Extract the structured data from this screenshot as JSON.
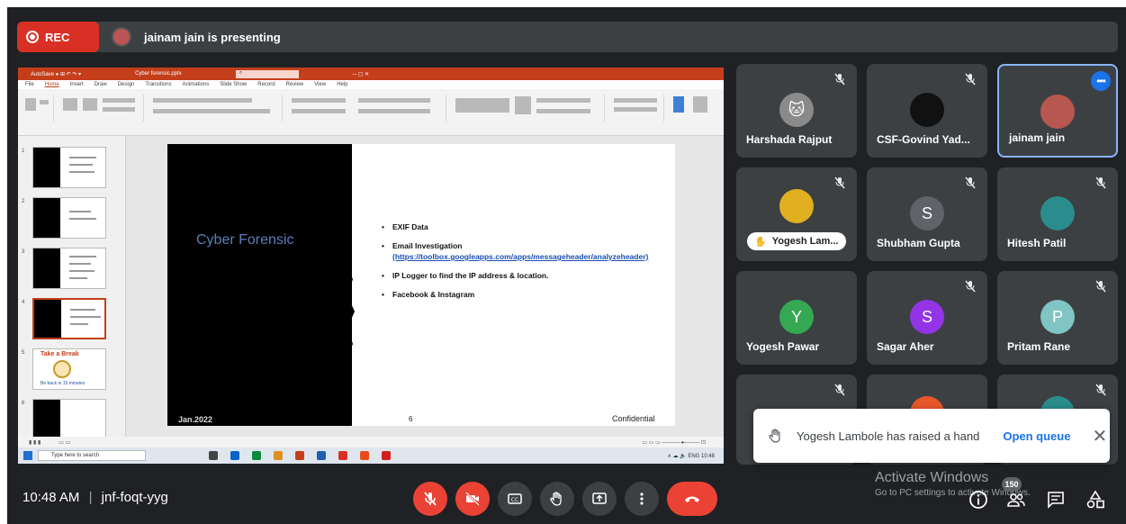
{
  "recording": {
    "label": "REC"
  },
  "presenter": {
    "text": "jainam jain is presenting"
  },
  "powerpoint": {
    "slide": {
      "title": "Cyber Forensic",
      "bullets": [
        "EXIF Data",
        "Email Investigation",
        "IP Logger to find the IP address & location.",
        "Facebook & Instagram"
      ],
      "link": "(https://toolbox.googleapps.com/apps/messageheader/analyzeheader)",
      "date": "Jan.2022",
      "page_number": "6",
      "footer": "Confidential"
    },
    "break_thumb": {
      "title": "Take a Break",
      "subtitle": "Be back in 15 minutes"
    },
    "taskbar_search": "Type here to search"
  },
  "participants": [
    {
      "name": "Harshada Rajput",
      "avatar": "photo",
      "color": "#8a8a8a"
    },
    {
      "name": "CSF-Govind Yad...",
      "avatar": "photo",
      "color": "#111111"
    },
    {
      "name": "jainam jain",
      "avatar": "photo",
      "color": "#b8574f"
    },
    {
      "name": "Yogesh Lam...",
      "avatar": "photo",
      "color": "#e0b020"
    },
    {
      "name": "Shubham Gupta",
      "avatar": "S",
      "color": "#5f6368"
    },
    {
      "name": "Hitesh Patil",
      "avatar": "photo",
      "color": "#2a8c8c"
    },
    {
      "name": "Yogesh Pawar",
      "avatar": "Y",
      "color": "#34a853"
    },
    {
      "name": "Sagar Aher",
      "avatar": "S",
      "color": "#9334e6"
    },
    {
      "name": "Pritam Rane",
      "avatar": "P",
      "color": "#80c4c4"
    }
  ],
  "toast": {
    "message": "Yogesh Lambole has raised a hand",
    "action": "Open queue"
  },
  "meeting": {
    "time": "10:48 AM",
    "separator": "|",
    "code": "jnf-foqt-yyg"
  },
  "people_count": "150",
  "watermark": {
    "line1": "Activate Windows",
    "line2": "Go to PC settings to activate Windows."
  },
  "colors": {
    "end_call": "#ea4335",
    "accent": "#1a73e8",
    "background": "#202124"
  }
}
